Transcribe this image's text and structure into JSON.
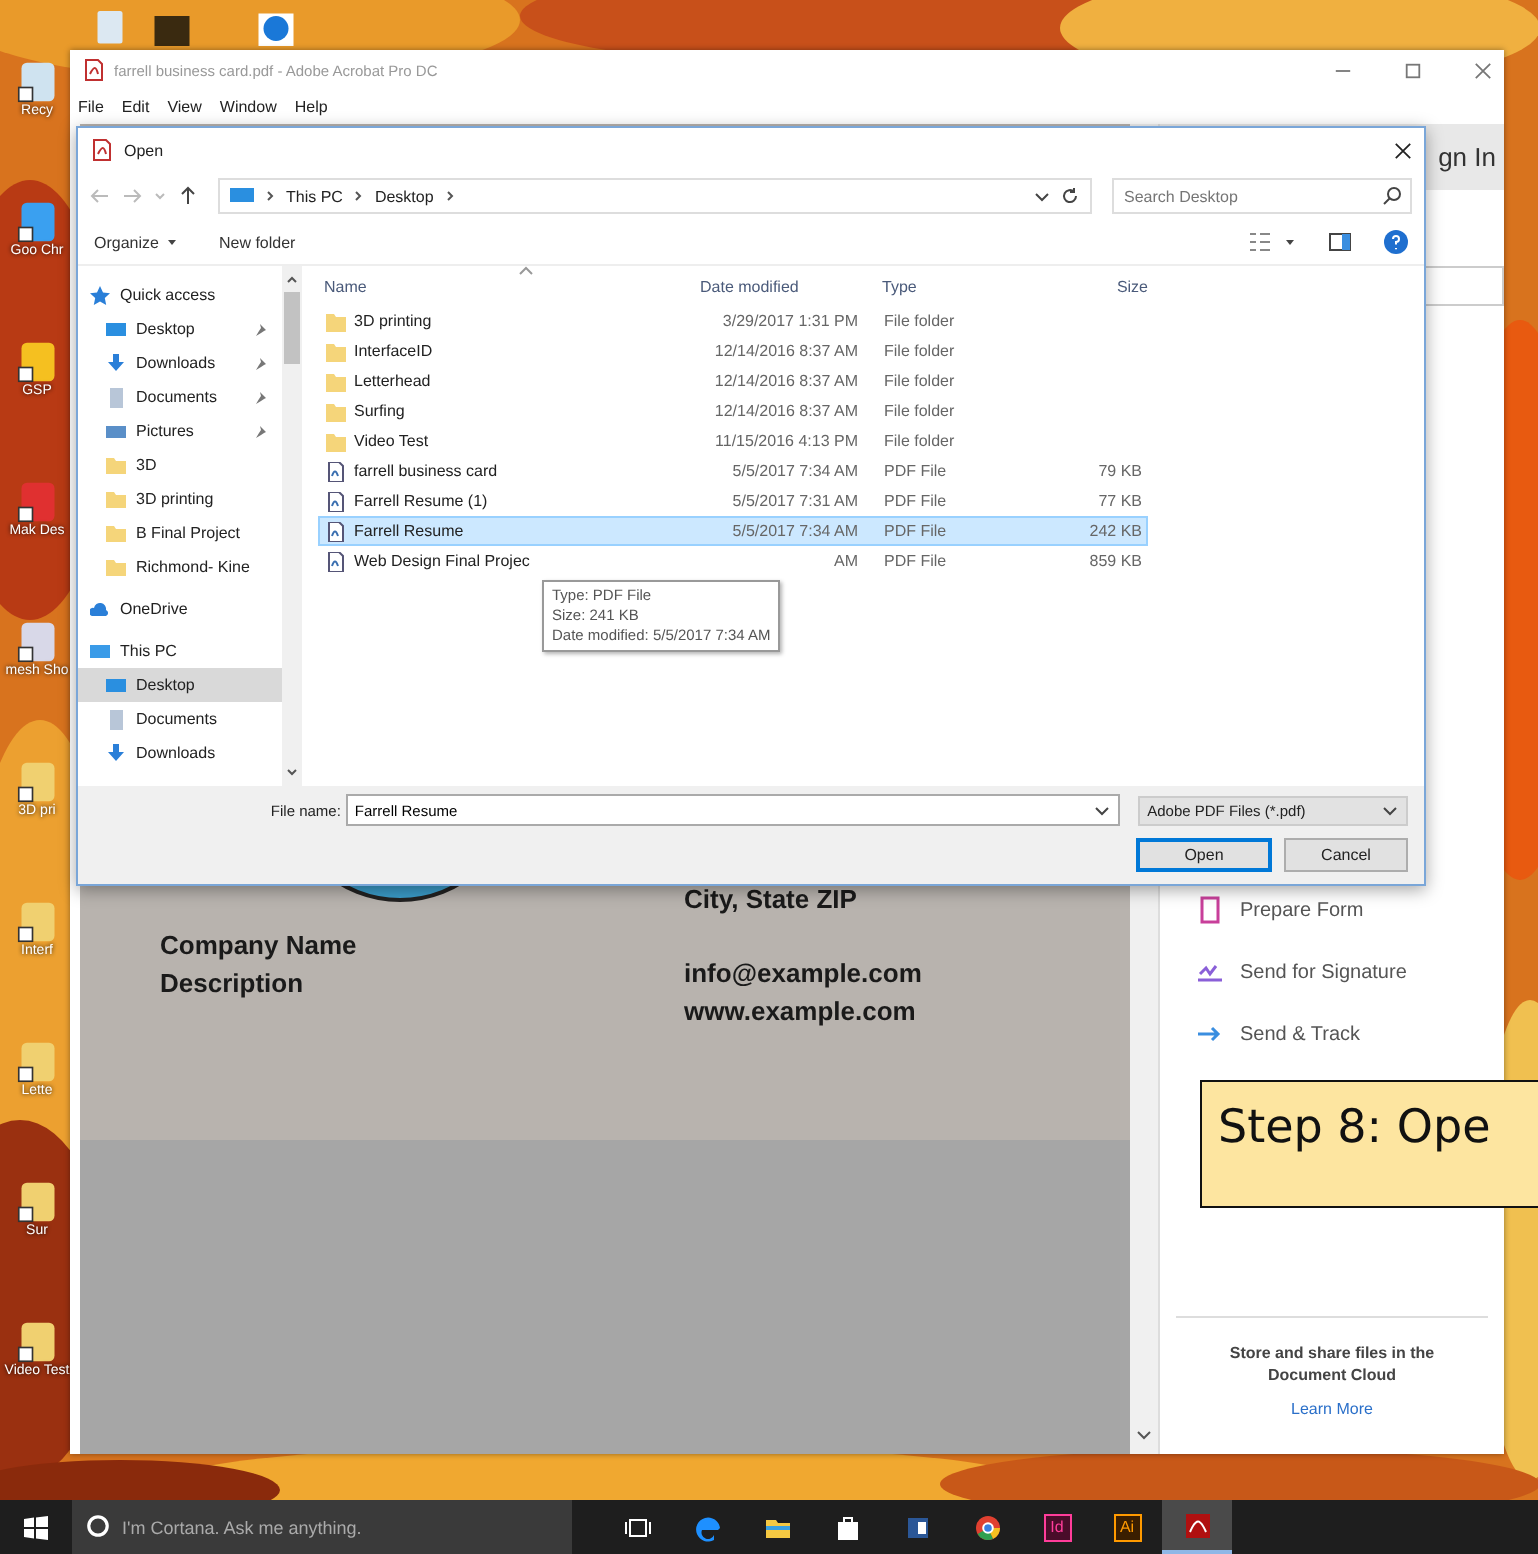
{
  "desktop": {
    "icons": [
      {
        "label": "Recy"
      },
      {
        "label": "Goo Chr"
      },
      {
        "label": "GSP"
      },
      {
        "label": "Mak Des"
      },
      {
        "label": "mesh Sho"
      },
      {
        "label": "3D pri"
      },
      {
        "label": "Interf"
      },
      {
        "label": "Lette"
      },
      {
        "label": "Sur"
      },
      {
        "label": "Video Test"
      }
    ]
  },
  "acrobat": {
    "title": "farrell business card.pdf - Adobe Acrobat Pro DC",
    "menu": [
      "File",
      "Edit",
      "View",
      "Window",
      "Help"
    ],
    "sign_in": "gn In",
    "card": {
      "left_lines": [
        "Company Name",
        "Description"
      ],
      "right_top": "City, State ZIP",
      "right_lines": [
        "info@example.com",
        "www.example.com"
      ]
    },
    "tools": [
      {
        "label": "Prepare Form",
        "kind": "form"
      },
      {
        "label": "Send for Signature",
        "kind": "sign"
      },
      {
        "label": "Send & Track",
        "kind": "track"
      }
    ],
    "cloud_text": "Store and share files in the Document Cloud",
    "learn_more": "Learn More"
  },
  "dialog": {
    "title": "Open",
    "breadcrumb": [
      "This PC",
      "Desktop"
    ],
    "search": {
      "placeholder": "Search Desktop"
    },
    "toolbar": [
      "Organize",
      "New folder"
    ],
    "nav": [
      {
        "label": "Quick access",
        "kind": "star",
        "selected": false,
        "children": [
          {
            "label": "Desktop",
            "kind": "desktop",
            "pinned": true,
            "selected": false
          },
          {
            "label": "Downloads",
            "kind": "download",
            "pinned": true,
            "selected": false
          },
          {
            "label": "Documents",
            "kind": "documents",
            "pinned": true,
            "selected": false
          },
          {
            "label": "Pictures",
            "kind": "pictures",
            "pinned": true,
            "selected": false
          },
          {
            "label": "3D",
            "kind": "folder",
            "pinned": false,
            "selected": false
          },
          {
            "label": "3D printing",
            "kind": "folder",
            "pinned": false,
            "selected": false
          },
          {
            "label": "B Final Project",
            "kind": "folder",
            "pinned": false,
            "selected": false
          },
          {
            "label": "Richmond- Kine",
            "kind": "folder",
            "pinned": false,
            "selected": false
          }
        ]
      },
      {
        "label": "OneDrive",
        "kind": "cloud",
        "selected": false
      },
      {
        "label": "This PC",
        "kind": "pc",
        "selected": false,
        "children": [
          {
            "label": "Desktop",
            "kind": "desktop",
            "pinned": false,
            "selected": true
          },
          {
            "label": "Documents",
            "kind": "documents",
            "pinned": false,
            "selected": false
          },
          {
            "label": "Downloads",
            "kind": "download",
            "pinned": false,
            "selected": false
          }
        ]
      }
    ],
    "columns": [
      "Name",
      "Date modified",
      "Type",
      "Size"
    ],
    "rows": [
      {
        "name": "3D printing",
        "date": "3/29/2017 1:31 PM",
        "type": "File folder",
        "size": "",
        "kind": "folder",
        "selected": false
      },
      {
        "name": "InterfaceID",
        "date": "12/14/2016 8:37 AM",
        "type": "File folder",
        "size": "",
        "kind": "folder",
        "selected": false
      },
      {
        "name": "Letterhead",
        "date": "12/14/2016 8:37 AM",
        "type": "File folder",
        "size": "",
        "kind": "folder",
        "selected": false
      },
      {
        "name": "Surfing",
        "date": "12/14/2016 8:37 AM",
        "type": "File folder",
        "size": "",
        "kind": "folder",
        "selected": false
      },
      {
        "name": "Video Test",
        "date": "11/15/2016 4:13 PM",
        "type": "File folder",
        "size": "",
        "kind": "folder",
        "selected": false
      },
      {
        "name": "farrell business card",
        "date": "5/5/2017 7:34 AM",
        "type": "PDF File",
        "size": "79 KB",
        "kind": "pdf",
        "selected": false
      },
      {
        "name": "Farrell Resume (1)",
        "date": "5/5/2017 7:31 AM",
        "type": "PDF File",
        "size": "77 KB",
        "kind": "pdf",
        "selected": false
      },
      {
        "name": "Farrell Resume",
        "date": "5/5/2017 7:34 AM",
        "type": "PDF File",
        "size": "242 KB",
        "kind": "pdf",
        "selected": true
      },
      {
        "name": "Web Design Final Projec",
        "date": "AM",
        "type": "PDF File",
        "size": "859 KB",
        "kind": "pdf",
        "selected": false
      }
    ],
    "tooltip": [
      "Type: PDF File",
      "Size: 241 KB",
      "Date modified: 5/5/2017 7:34 AM"
    ],
    "file_name": {
      "label": "File name:",
      "value": "Farrell Resume"
    },
    "filter": "Adobe PDF Files (*.pdf)",
    "buttons": [
      {
        "label": "Open",
        "default": true
      },
      {
        "label": "Cancel",
        "default": false
      }
    ]
  },
  "step_note": "Step 8: Ope",
  "taskbar": {
    "search": {
      "placeholder": "I'm Cortana. Ask me anything."
    },
    "apps": [
      {
        "kind": "taskview",
        "selected": false
      },
      {
        "kind": "edge",
        "selected": false
      },
      {
        "kind": "explorer",
        "selected": false
      },
      {
        "kind": "store",
        "selected": false
      },
      {
        "kind": "word",
        "selected": false
      },
      {
        "kind": "chrome",
        "selected": false
      },
      {
        "kind": "indesign",
        "label": "Id",
        "selected": false
      },
      {
        "kind": "illustrator",
        "label": "Ai",
        "selected": false
      },
      {
        "kind": "acrobat",
        "selected": true
      }
    ]
  }
}
